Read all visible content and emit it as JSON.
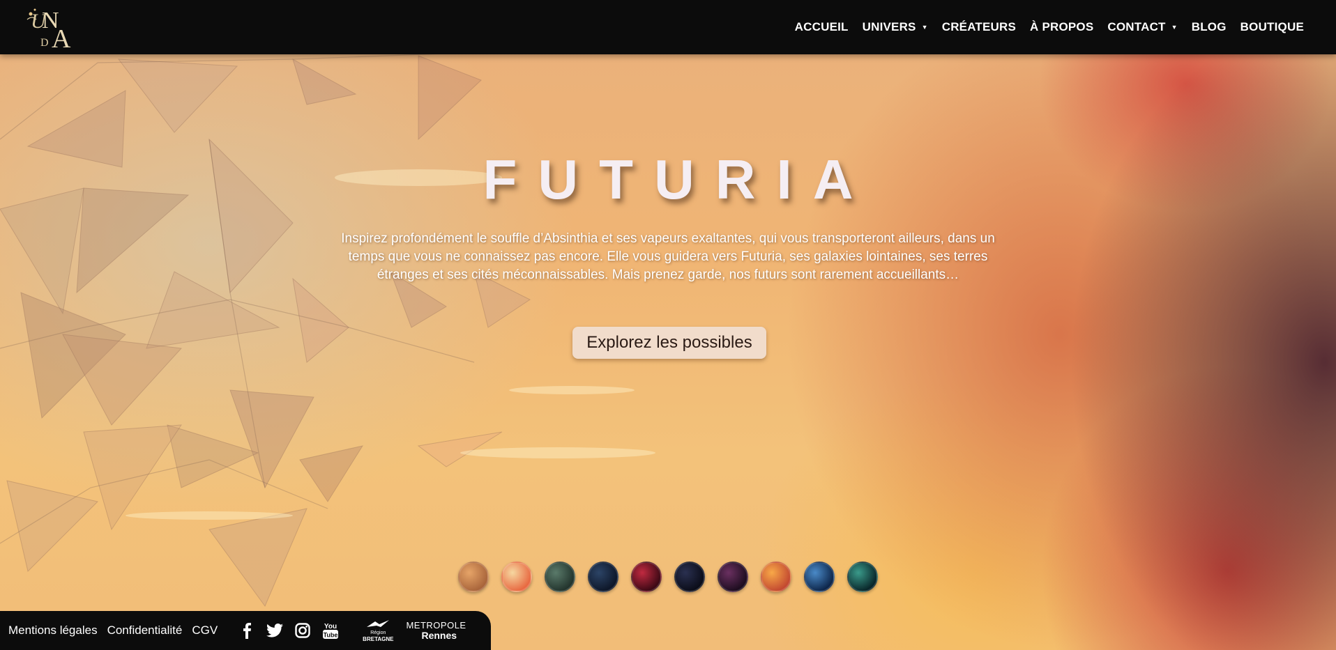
{
  "header": {
    "logo_letters": "UNDA",
    "nav": [
      {
        "label": "ACCUEIL",
        "dropdown": false
      },
      {
        "label": "UNIVERS",
        "dropdown": true
      },
      {
        "label": "CRÉATEURS",
        "dropdown": false
      },
      {
        "label": "À PROPOS",
        "dropdown": false
      },
      {
        "label": "CONTACT",
        "dropdown": true
      },
      {
        "label": "BLOG",
        "dropdown": false
      },
      {
        "label": "BOUTIQUE",
        "dropdown": false
      }
    ],
    "caret": "▼"
  },
  "hero": {
    "title": "FUTURIA",
    "intro": "Inspirez profondément le souffle d’Absinthia et ses vapeurs exaltantes, qui vous transporteront ailleurs, dans un temps que vous ne connaissez pas encore. Elle vous guidera vers Futuria, ses galaxies lointaines, ses terres étranges et ses cités méconnaissables. Mais prenez garde, nos futurs sont rarement accueillants…",
    "cta_label": "Explorez les possibles"
  },
  "planets": [
    {
      "name": "planet-1-icon",
      "colors": [
        "#e6a468",
        "#a8643a"
      ]
    },
    {
      "name": "planet-2-icon",
      "colors": [
        "#f6d7a0",
        "#e86840"
      ]
    },
    {
      "name": "planet-3-icon",
      "colors": [
        "#5a7a6a",
        "#22332c"
      ]
    },
    {
      "name": "planet-4-icon",
      "colors": [
        "#2c4466",
        "#0d1628"
      ]
    },
    {
      "name": "planet-5-icon",
      "colors": [
        "#c02a40",
        "#3a0814"
      ]
    },
    {
      "name": "planet-6-icon",
      "colors": [
        "#2a3050",
        "#0a0c18"
      ]
    },
    {
      "name": "planet-7-icon",
      "colors": [
        "#6a3060",
        "#1c0c1e"
      ]
    },
    {
      "name": "planet-8-icon",
      "colors": [
        "#f8a848",
        "#c24830"
      ]
    },
    {
      "name": "planet-9-icon",
      "colors": [
        "#4a8ac8",
        "#0c2448"
      ]
    },
    {
      "name": "planet-10-icon",
      "colors": [
        "#3a9a8a",
        "#082428"
      ]
    }
  ],
  "footer": {
    "links": [
      "Mentions légales",
      "Confidentialité",
      "CGV"
    ],
    "socials": [
      "facebook-icon",
      "twitter-icon",
      "instagram-icon",
      "youtube-icon"
    ],
    "youtube_text": "You Tube",
    "partners": {
      "bretagne_line1": "Région",
      "bretagne_line2": "BRETAGNE",
      "rennes_line1": "METROPOLE",
      "rennes_line2": "Rennes"
    }
  },
  "colors": {
    "bar": "#0c0c0c",
    "cta_bg": "#f1dccb",
    "title": "#f5eef3"
  }
}
